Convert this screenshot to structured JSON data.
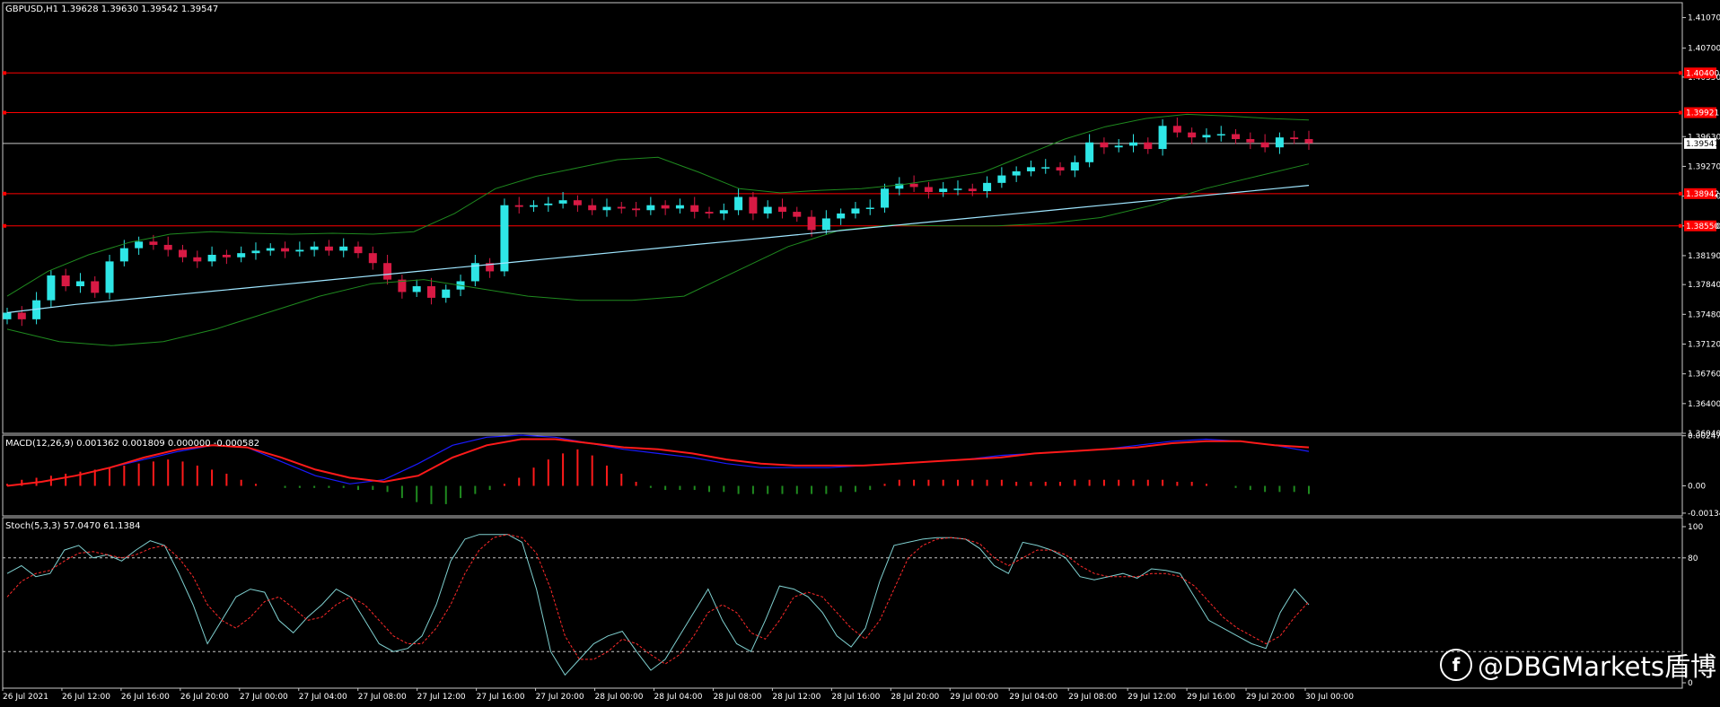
{
  "colors": {
    "background": "#000000",
    "grid_frame": "#c8c8c8",
    "bull": "#2ee6e6",
    "bear": "#d81a44",
    "bands": "#1f8a1f",
    "ma": "#9fe6ff",
    "macd_line": "#ff1a1a",
    "signal_line": "#1a1aff",
    "hist_pos": "#ff1a1a",
    "hist_neg": "#1f8a1f",
    "stoch_main": "#7fd0d0",
    "stoch_signal": "#ff2a2a",
    "level_line": "#ff0000"
  },
  "main_title": "GBPUSD,H1  1.39628 1.39630 1.39542 1.39547",
  "macd_title": "MACD(12,26,9) 0.001362 0.001809 0.000000 -0.000582",
  "stoch_title": "Stoch(5,3,3) 57.0470 61.1384",
  "watermark": {
    "logo": "f",
    "text": "@DBGMarkets盾博"
  },
  "chart_data": [
    {
      "type": "candlestick",
      "symbol": "GBPUSD",
      "timeframe": "H1",
      "ylim": [
        1.3604,
        1.4125
      ],
      "y_ticks": [
        "1.41070",
        "1.40700",
        "1.40350",
        "1.39630",
        "1.39270",
        "1.38910",
        "1.38550",
        "1.38190",
        "1.37840",
        "1.37480",
        "1.37120",
        "1.36760",
        "1.36400",
        "1.36040"
      ],
      "x_ticks": [
        "26 Jul 2021",
        "26 Jul 12:00",
        "26 Jul 16:00",
        "26 Jul 20:00",
        "27 Jul 00:00",
        "27 Jul 04:00",
        "27 Jul 08:00",
        "27 Jul 12:00",
        "27 Jul 16:00",
        "27 Jul 20:00",
        "28 Jul 00:00",
        "28 Jul 04:00",
        "28 Jul 08:00",
        "28 Jul 12:00",
        "28 Jul 16:00",
        "28 Jul 20:00",
        "29 Jul 00:00",
        "29 Jul 04:00",
        "29 Jul 08:00",
        "29 Jul 12:00",
        "29 Jul 16:00",
        "29 Jul 20:00",
        "30 Jul 00:00"
      ],
      "current_price": "1.39547",
      "price_levels": [
        {
          "value": 1.404,
          "label": "1.40400"
        },
        {
          "value": 1.3992,
          "label": "1.39921"
        },
        {
          "value": 1.3894,
          "label": "1.38942"
        },
        {
          "value": 1.3855,
          "label": "1.38550"
        }
      ],
      "closes": [
        1.375,
        1.3742,
        1.3765,
        1.3795,
        1.3782,
        1.3788,
        1.3774,
        1.3812,
        1.3828,
        1.3836,
        1.3832,
        1.3826,
        1.3817,
        1.3812,
        1.382,
        1.3817,
        1.3822,
        1.3825,
        1.3828,
        1.3824,
        1.3826,
        1.383,
        1.3825,
        1.383,
        1.3822,
        1.381,
        1.379,
        1.3775,
        1.3782,
        1.3768,
        1.3778,
        1.3788,
        1.381,
        1.38,
        1.388,
        1.3878,
        1.388,
        1.3882,
        1.3886,
        1.388,
        1.3874,
        1.3878,
        1.3876,
        1.3874,
        1.388,
        1.3876,
        1.388,
        1.3872,
        1.387,
        1.3874,
        1.389,
        1.387,
        1.3878,
        1.3872,
        1.3866,
        1.385,
        1.3864,
        1.387,
        1.3876,
        1.3877,
        1.39,
        1.3906,
        1.3902,
        1.3896,
        1.39,
        1.39,
        1.3897,
        1.3907,
        1.3916,
        1.3921,
        1.3926,
        1.3926,
        1.3922,
        1.3932,
        1.3956,
        1.395,
        1.3952,
        1.3956,
        1.3948,
        1.3976,
        1.3968,
        1.3962,
        1.3965,
        1.3966,
        1.396,
        1.3956,
        1.395,
        1.3962,
        1.396,
        1.3955
      ],
      "ma_values": [
        1.375,
        1.3755,
        1.376,
        1.3764,
        1.3768,
        1.3772,
        1.3776,
        1.378,
        1.3784,
        1.3788,
        1.3792,
        1.3796,
        1.38,
        1.3804,
        1.3808,
        1.3812,
        1.3816,
        1.382,
        1.3824,
        1.3828,
        1.3832,
        1.3836,
        1.384,
        1.3844,
        1.3848,
        1.3852,
        1.3856,
        1.386,
        1.3864,
        1.3868,
        1.3872,
        1.3876,
        1.388,
        1.3884,
        1.3888,
        1.3892,
        1.3896,
        1.39,
        1.3904
      ],
      "upper_band": [
        1.377,
        1.38,
        1.382,
        1.3835,
        1.3845,
        1.3848,
        1.3846,
        1.3845,
        1.3846,
        1.3845,
        1.3848,
        1.387,
        1.39,
        1.3915,
        1.3925,
        1.3935,
        1.3938,
        1.392,
        1.39,
        1.3895,
        1.3898,
        1.39,
        1.3905,
        1.3912,
        1.392,
        1.394,
        1.396,
        1.3975,
        1.3985,
        1.399,
        1.3988,
        1.3985,
        1.3983
      ],
      "lower_band": [
        1.373,
        1.3715,
        1.371,
        1.3715,
        1.373,
        1.375,
        1.377,
        1.3785,
        1.379,
        1.378,
        1.377,
        1.3765,
        1.3765,
        1.377,
        1.38,
        1.383,
        1.385,
        1.3856,
        1.3855,
        1.3855,
        1.3858,
        1.3865,
        1.388,
        1.39,
        1.3915,
        1.393
      ]
    },
    {
      "type": "macd",
      "params": "12,26,9",
      "y_ticks": [
        "0.00247",
        "0.00",
        "-0.001344"
      ],
      "ylim": [
        -0.00148,
        0.0025
      ],
      "macd": [
        0.0,
        0.0002,
        0.0005,
        0.0009,
        0.0014,
        0.0018,
        0.002,
        0.0019,
        0.0014,
        0.0008,
        0.0004,
        0.0002,
        0.0005,
        0.0014,
        0.002,
        0.0023,
        0.0023,
        0.0021,
        0.0019,
        0.0018,
        0.0016,
        0.0013,
        0.0011,
        0.001,
        0.001,
        0.001,
        0.0011,
        0.0012,
        0.0013,
        0.0014,
        0.0016,
        0.0017,
        0.0018,
        0.0019,
        0.0021,
        0.0022,
        0.0022,
        0.002,
        0.0019
      ],
      "signal": [
        0.0,
        0.0002,
        0.0005,
        0.0009,
        0.0013,
        0.0017,
        0.002,
        0.0019,
        0.0012,
        0.0005,
        0.0001,
        0.0003,
        0.0011,
        0.002,
        0.0024,
        0.0025,
        0.0024,
        0.0021,
        0.0018,
        0.0016,
        0.0014,
        0.0011,
        0.0009,
        0.0009,
        0.0009,
        0.001,
        0.0011,
        0.0012,
        0.0013,
        0.0015,
        0.0016,
        0.0017,
        0.0018,
        0.002,
        0.0022,
        0.0023,
        0.0022,
        0.002,
        0.0017
      ],
      "histogram": [
        0.0001,
        0.0003,
        0.0004,
        0.0005,
        0.0006,
        0.0007,
        0.0008,
        0.0009,
        0.001,
        0.0011,
        0.0012,
        0.0013,
        0.0012,
        0.001,
        0.0008,
        0.0006,
        0.0003,
        0.0001,
        0.0,
        -0.0001,
        -0.0001,
        -0.0001,
        -0.0001,
        -0.0001,
        -0.0002,
        -0.0002,
        -0.0003,
        -0.0006,
        -0.0008,
        -0.0009,
        -0.0009,
        -0.0006,
        -0.0004,
        -0.0002,
        0.0001,
        0.0004,
        0.0009,
        0.0013,
        0.0016,
        0.0018,
        0.0015,
        0.001,
        0.0006,
        0.0002,
        -0.0001,
        -0.0002,
        -0.0002,
        -0.0002,
        -0.0003,
        -0.0003,
        -0.0004,
        -0.0004,
        -0.0004,
        -0.0004,
        -0.0004,
        -0.0004,
        -0.0004,
        -0.0003,
        -0.0003,
        -0.0002,
        0.0001,
        0.0003,
        0.0003,
        0.0003,
        0.0003,
        0.0003,
        0.0003,
        0.0003,
        0.0003,
        0.0002,
        0.0002,
        0.0002,
        0.0002,
        0.0003,
        0.0003,
        0.0003,
        0.0003,
        0.0003,
        0.0003,
        0.0003,
        0.0002,
        0.0002,
        0.0001,
        0.0,
        -0.0001,
        -0.0002,
        -0.0003,
        -0.0003,
        -0.0003,
        -0.0004
      ]
    },
    {
      "type": "stochastic",
      "params": "5,3,3",
      "ylim": [
        0,
        100
      ],
      "y_ticks": [
        "100",
        "80",
        "0"
      ],
      "levels": [
        80,
        20
      ],
      "main": [
        70,
        75,
        68,
        70,
        85,
        88,
        80,
        82,
        78,
        85,
        91,
        88,
        70,
        50,
        25,
        40,
        55,
        60,
        58,
        40,
        32,
        42,
        50,
        60,
        55,
        40,
        25,
        20,
        22,
        30,
        50,
        78,
        92,
        95,
        95,
        95,
        90,
        60,
        20,
        5,
        15,
        25,
        30,
        33,
        20,
        8,
        15,
        30,
        45,
        60,
        40,
        25,
        20,
        40,
        62,
        60,
        55,
        45,
        30,
        23,
        35,
        65,
        88,
        90,
        92,
        93,
        93,
        92,
        86,
        75,
        70,
        90,
        88,
        85,
        80,
        68,
        66,
        68,
        70,
        67,
        73,
        72,
        70,
        55,
        40,
        35,
        30,
        25,
        22,
        45,
        60,
        50
      ],
      "signal": [
        55,
        65,
        70,
        72,
        78,
        83,
        84,
        82,
        80,
        82,
        86,
        88,
        80,
        68,
        50,
        40,
        35,
        42,
        52,
        55,
        48,
        40,
        42,
        50,
        55,
        50,
        40,
        30,
        25,
        25,
        35,
        50,
        70,
        85,
        93,
        95,
        93,
        83,
        60,
        30,
        15,
        15,
        20,
        28,
        25,
        18,
        12,
        18,
        30,
        45,
        50,
        45,
        32,
        28,
        40,
        55,
        58,
        55,
        45,
        35,
        28,
        40,
        60,
        80,
        88,
        92,
        93,
        92,
        89,
        80,
        75,
        80,
        85,
        85,
        82,
        75,
        70,
        68,
        68,
        68,
        70,
        70,
        68,
        62,
        52,
        42,
        35,
        30,
        25,
        30,
        42,
        52
      ]
    }
  ]
}
